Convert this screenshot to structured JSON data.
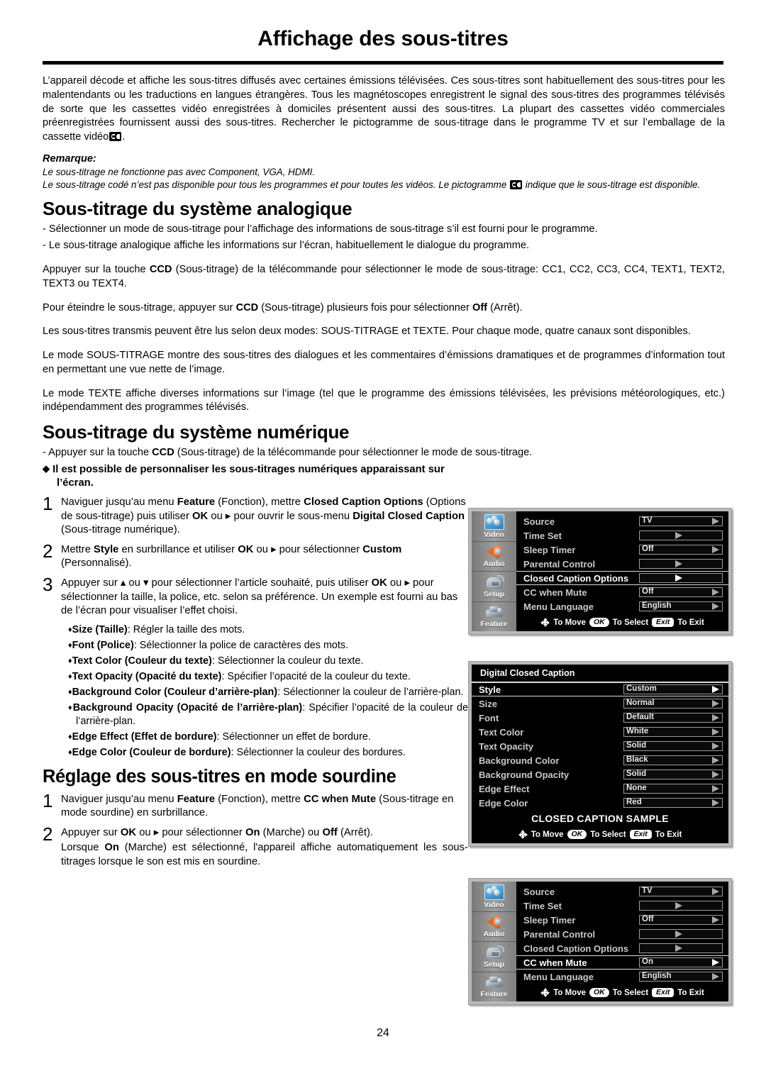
{
  "header": {
    "title": "Affichage des sous-titres"
  },
  "intro": {
    "paragraph": "L’appareil décode et affiche les sous-titres diffusés avec certaines émissions télévisées. Ces sous-titres sont habituellement des sous-titres pour les malentendants ou les traductions en langues étrangères. Tous les magnétoscopes enregistrent le signal des sous-titres des programmes télévisés de sorte que les cassettes vidéo enregistrées à domiciles présentent aussi des sous-titres. La plupart des cassettes vidéo commerciales préenregistrées fournissent aussi des sous-titres. Rechercher le pictogramme de sous-titrage dans le programme TV et sur l’emballage de la cassette vidéo",
    "paragraph_end": "."
  },
  "remark": {
    "label": "Remarque:",
    "line1": "Le sous-titrage ne fonctionne pas avec Component, VGA, HDMI.",
    "line2_a": "Le sous-titrage codé n’est pas disponible pour tous les programmes et pour toutes les vidéos. Le pictogramme",
    "line2_b": "indique que le sous-titrage est disponible."
  },
  "analog": {
    "heading": "Sous-titrage du système analogique",
    "dash1": "- Sélectionner un mode de sous-titrage pour l’affichage des informations de sous-titrage s’il est fourni pour le programme.",
    "dash2": "- Le sous-titrage analogique affiche les informations sur l’écran, habituellement le dialogue du programme.",
    "p1_a": "Appuyer sur la touche",
    "p1_ccd": "CCD",
    "p1_b": "(Sous-titrage) de la télécommande pour sélectionner le mode de sous-titrage: CC1, CC2, CC3, CC4, TEXT1, TEXT2, TEXT3 ou TEXT4.",
    "p2_a": "Pour éteindre le sous-titrage, appuyer sur",
    "p2_ccd": "CCD",
    "p2_b": "(Sous-titrage) plusieurs fois pour sélectionner",
    "p2_off": "Off",
    "p2_c": "(Arrêt).",
    "p3": "Les sous-titres transmis peuvent être lus selon deux modes: SOUS-TITRAGE et TEXTE. Pour chaque mode, quatre canaux sont disponibles.",
    "p4": "Le mode SOUS-TITRAGE montre des sous-titres des dialogues et les commentaires d’émissions dramatiques et de programmes d’information tout en permettant une vue nette de l’image.",
    "p5": "Le mode TEXTE affiche diverses informations sur l’image (tel que le programme des émissions télévisées, les prévisions météorologiques, etc.) indépendamment des programmes télévisés."
  },
  "digital": {
    "heading": "Sous-titrage du système numérique",
    "dash1_a": "- Appuyer sur la touche",
    "dash1_ccd": "CCD",
    "dash1_b": "(Sous-titrage) de la télécommande pour sélectionner le mode de sous-titrage.",
    "bullet_head": "Il est possible de personnaliser les sous-titrages numériques apparaissant sur l’écran.",
    "steps": [
      {
        "num": "1",
        "parts": [
          {
            "t": "Naviguer jusqu’au menu ",
            "b": false
          },
          {
            "t": "Feature",
            "b": true
          },
          {
            "t": " (Fonction), mettre ",
            "b": false
          },
          {
            "t": "Closed Caption Options",
            "b": true
          },
          {
            "t": " (Options de sous-titrage) puis utiliser ",
            "b": false
          },
          {
            "t": "OK",
            "b": true
          },
          {
            "t": " ou ▸ pour ouvrir le sous-menu ",
            "b": false
          },
          {
            "t": "Digital Closed Caption",
            "b": true
          },
          {
            "t": " (Sous-titrage numérique).",
            "b": false
          }
        ]
      },
      {
        "num": "2",
        "parts": [
          {
            "t": "Mettre ",
            "b": false
          },
          {
            "t": "Style",
            "b": true
          },
          {
            "t": " en surbrillance et utiliser ",
            "b": false
          },
          {
            "t": "OK",
            "b": true
          },
          {
            "t": " ou ▸ pour sélectionner ",
            "b": false
          },
          {
            "t": "Custom",
            "b": true
          },
          {
            "t": " (Personnalisé).",
            "b": false
          }
        ]
      },
      {
        "num": "3",
        "parts": [
          {
            "t": "Appuyer sur ▴ ou ▾ pour sélectionner l’article souhaité, puis utiliser ",
            "b": false
          },
          {
            "t": "OK",
            "b": true
          },
          {
            "t": " ou ▸ pour sélectionner la taille, la police, etc. selon sa préférence. Un exemple est fourni au bas de l’écran pour visualiser l’effet choisi.",
            "b": false
          }
        ]
      }
    ],
    "options": [
      {
        "term": "Size (Taille)",
        "desc": ": Régler la taille des mots."
      },
      {
        "term": "Font (Police)",
        "desc": ": Sélectionner la police de caractères des mots."
      },
      {
        "term": "Text Color (Couleur du texte)",
        "desc": ": Sélectionner la couleur du texte."
      },
      {
        "term": "Text Opacity (Opacité du texte)",
        "desc": ": Spécifier l’opacité de la couleur du texte."
      },
      {
        "term": "Background Color (Couleur d’arrière-plan)",
        "desc": ": Sélectionner la couleur de l’arrière-plan."
      },
      {
        "term": "Background Opacity (Opacité de l’arrière-plan)",
        "desc": ": Spécifier l’opacité de la couleur de l’arrière-plan."
      },
      {
        "term": "Edge Effect (Effet de bordure)",
        "desc": ": Sélectionner un effet de bordure."
      },
      {
        "term": "Edge Color (Couleur de bordure)",
        "desc": ": Sélectionner la couleur des bordures."
      }
    ]
  },
  "mute": {
    "heading": "Réglage des sous-titres en mode sourdine",
    "steps": [
      {
        "num": "1",
        "parts": [
          {
            "t": "Naviguer jusqu’au menu ",
            "b": false
          },
          {
            "t": "Feature",
            "b": true
          },
          {
            "t": " (Fonction), mettre ",
            "b": false
          },
          {
            "t": "CC when Mute",
            "b": true
          },
          {
            "t": " (Sous-titrage en mode sourdine) en surbrillance.",
            "b": false
          }
        ]
      },
      {
        "num": "2",
        "parts": [
          {
            "t": "Appuyer sur ",
            "b": false
          },
          {
            "t": "OK",
            "b": true
          },
          {
            "t": " ou ▸ pour sélectionner ",
            "b": false
          },
          {
            "t": "On",
            "b": true
          },
          {
            "t": " (Marche) ou ",
            "b": false
          },
          {
            "t": "Off",
            "b": true
          },
          {
            "t": " (Arrêt).",
            "b": false
          }
        ]
      }
    ],
    "trailing": [
      {
        "t": "Lorsque ",
        "b": false
      },
      {
        "t": "On",
        "b": true
      },
      {
        "t": " (Marche) est sélectionné, l'appareil affiche automatiquement les sous-titrages lorsque le son est mis en sourdine.",
        "b": false
      }
    ]
  },
  "osd": {
    "tabs": [
      {
        "label": "Video",
        "icon": "video-icon"
      },
      {
        "label": "Audio",
        "icon": "audio-icon"
      },
      {
        "label": "Setup",
        "icon": "setup-icon"
      },
      {
        "label": "Feature",
        "icon": "feature-icon"
      }
    ],
    "hint": {
      "move": "To Move",
      "ok": "OK",
      "select": "To Select",
      "exit": "Exit",
      "exit_label": "To Exit"
    },
    "feature_menu_1": {
      "rows": [
        {
          "label": "Source",
          "value": "TV",
          "selected": false,
          "blank": false
        },
        {
          "label": "Time Set",
          "value": "",
          "selected": false,
          "blank": true
        },
        {
          "label": "Sleep Timer",
          "value": "Off",
          "selected": false,
          "blank": false
        },
        {
          "label": "Parental Control",
          "value": "",
          "selected": false,
          "blank": true
        },
        {
          "label": "Closed Caption Options",
          "value": "",
          "selected": true,
          "blank": true
        },
        {
          "label": "CC when Mute",
          "value": "Off",
          "selected": false,
          "blank": false
        },
        {
          "label": "Menu Language",
          "value": "English",
          "selected": false,
          "blank": false
        }
      ]
    },
    "digital_menu": {
      "title": "Digital Closed Caption",
      "rows": [
        {
          "label": "Style",
          "value": "Custom",
          "selected": true
        },
        {
          "label": "Size",
          "value": "Normal",
          "selected": false
        },
        {
          "label": "Font",
          "value": "Default",
          "selected": false
        },
        {
          "label": "Text Color",
          "value": "White",
          "selected": false
        },
        {
          "label": "Text Opacity",
          "value": "Solid",
          "selected": false
        },
        {
          "label": "Background Color",
          "value": "Black",
          "selected": false
        },
        {
          "label": "Background Opacity",
          "value": "Solid",
          "selected": false
        },
        {
          "label": "Edge Effect",
          "value": "None",
          "selected": false
        },
        {
          "label": "Edge Color",
          "value": "Red",
          "selected": false
        }
      ],
      "sample": "CLOSED CAPTION SAMPLE"
    },
    "feature_menu_2": {
      "rows": [
        {
          "label": "Source",
          "value": "TV",
          "selected": false,
          "blank": false
        },
        {
          "label": "Time Set",
          "value": "",
          "selected": false,
          "blank": true
        },
        {
          "label": "Sleep Timer",
          "value": "Off",
          "selected": false,
          "blank": false
        },
        {
          "label": "Parental Control",
          "value": "",
          "selected": false,
          "blank": true
        },
        {
          "label": "Closed Caption Options",
          "value": "",
          "selected": false,
          "blank": true
        },
        {
          "label": "CC when Mute",
          "value": "On",
          "selected": true,
          "blank": false
        },
        {
          "label": "Menu Language",
          "value": "English",
          "selected": false,
          "blank": false
        }
      ]
    }
  },
  "footer": {
    "page_number": "24"
  }
}
